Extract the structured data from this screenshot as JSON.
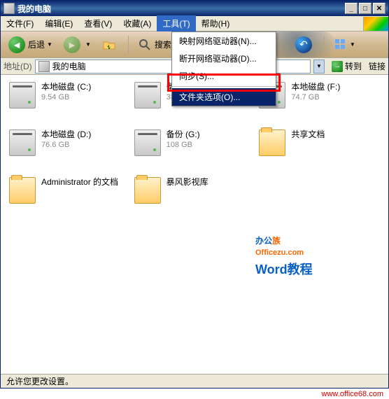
{
  "title": "我的电脑",
  "menus": {
    "file": "文件(F)",
    "edit": "编辑(E)",
    "view": "查看(V)",
    "favorites": "收藏(A)",
    "tools": "工具(T)",
    "help": "帮助(H)"
  },
  "tools_dropdown": {
    "map_drive": "映射网络驱动器(N)...",
    "disconnect": "断开网络驱动器(D)...",
    "sync": "同步(S)...",
    "folder_options": "文件夹选项(O)..."
  },
  "toolbar": {
    "back": "后退",
    "search": "搜索"
  },
  "addressbar": {
    "label": "地址(D)",
    "value": "我的电脑",
    "go": "转到",
    "links": "链接"
  },
  "items": [
    {
      "type": "drive",
      "name": "本地磁盘 (C:)",
      "sub": "9.54 GB"
    },
    {
      "type": "drive",
      "name": "备份 (E:)",
      "sub": "38.5 GB"
    },
    {
      "type": "drive",
      "name": "本地磁盘 (F:)",
      "sub": "74.7 GB"
    },
    {
      "type": "drive",
      "name": "本地磁盘 (D:)",
      "sub": "76.6 GB"
    },
    {
      "type": "drive",
      "name": "备份 (G:)",
      "sub": "108 GB"
    },
    {
      "type": "folder",
      "name": "共享文档",
      "sub": ""
    },
    {
      "type": "folder",
      "name": "Administrator 的文档",
      "sub": ""
    },
    {
      "type": "folder",
      "name": "暴风影视库",
      "sub": ""
    }
  ],
  "watermark": {
    "line1a": "办公",
    "line1b": "族",
    "line2": "Officezu.com",
    "line3": "Word教程"
  },
  "statusbar": "允许您更改设置。",
  "footer_url": "www.office68.com"
}
